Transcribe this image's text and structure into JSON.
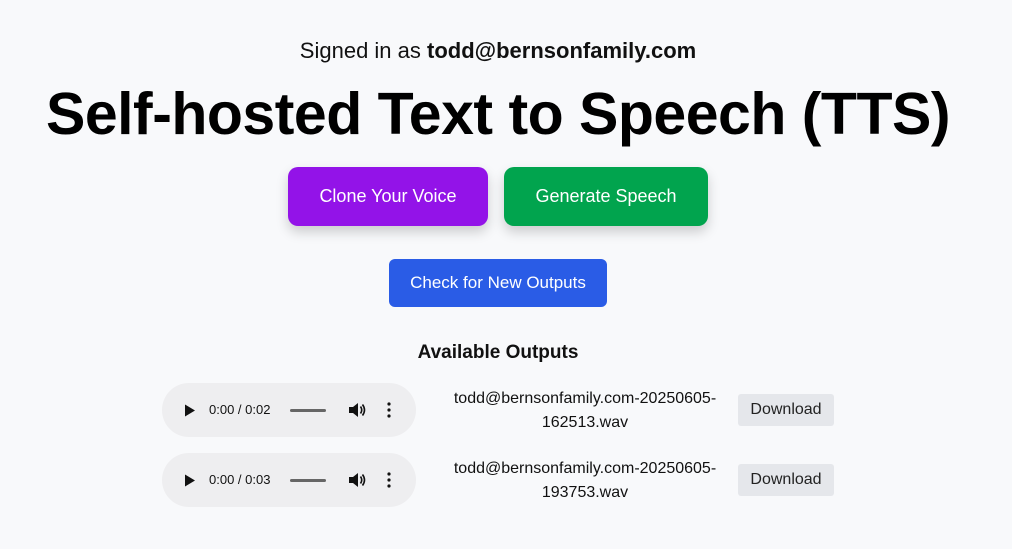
{
  "header": {
    "signed_in_prefix": "Signed in as",
    "user_email": "todd@bernsonfamily.com",
    "title": "Self-hosted Text to Speech (TTS)"
  },
  "actions": {
    "clone_label": "Clone Your Voice",
    "generate_label": "Generate Speech",
    "check_label": "Check for New Outputs",
    "clone_color": "#9313e8",
    "generate_color": "#01a44e",
    "check_color": "#2a5ce6"
  },
  "outputs": {
    "heading": "Available Outputs",
    "items": [
      {
        "time": "0:00 / 0:02",
        "filename_line1": "todd@bernsonfamily.com-20250605-",
        "filename_line2": "162513.wav",
        "download_label": "Download"
      },
      {
        "time": "0:00 / 0:03",
        "filename_line1": "todd@bernsonfamily.com-20250605-",
        "filename_line2": "193753.wav",
        "download_label": "Download"
      }
    ]
  },
  "icons": {
    "play": "play-icon",
    "volume": "volume-icon",
    "more": "more-vertical-icon"
  }
}
